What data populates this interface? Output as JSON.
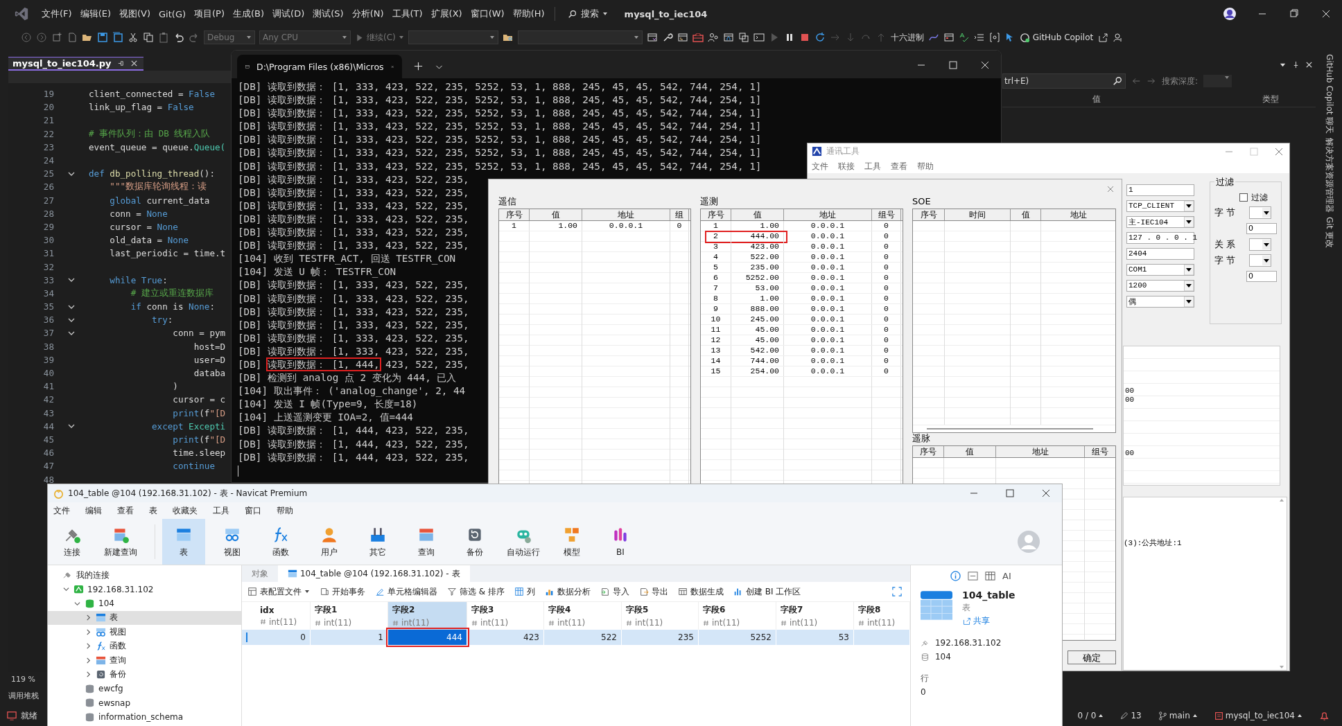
{
  "ide": {
    "menu": [
      "文件(F)",
      "编辑(E)",
      "视图(V)",
      "Git(G)",
      "项目(P)",
      "生成(B)",
      "调试(D)",
      "测试(S)",
      "分析(N)",
      "工具(T)",
      "扩展(X)",
      "窗口(W)",
      "帮助(H)"
    ],
    "search": "搜索",
    "title": "mysql_to_iec104",
    "toolbar": {
      "configuration": "Debug",
      "platform": "Any CPU",
      "continue": "继续(C)",
      "hex": "十六进制",
      "copilot": "GitHub Copilot"
    },
    "editor_tab": {
      "label": "mysql_to_iec104.py",
      "selected": true
    },
    "code": [
      {
        "number": "19",
        "tokens": [
          {
            "t": "client_connected = ",
            "kind": "plain"
          },
          {
            "t": "False",
            "kind": "keyword"
          }
        ]
      },
      {
        "number": "20",
        "tokens": [
          {
            "t": "link_up_flag = ",
            "kind": "plain"
          },
          {
            "t": "False",
            "kind": "keyword"
          }
        ]
      },
      {
        "number": "21"
      },
      {
        "number": "22",
        "tokens": [
          {
            "t": "# 事件队列：由 DB 线程入队",
            "kind": "comment"
          }
        ]
      },
      {
        "number": "23",
        "tokens": [
          {
            "t": "event_queue = queue.",
            "kind": "plain"
          },
          {
            "t": "Queue(",
            "kind": "class"
          }
        ]
      },
      {
        "number": "24"
      },
      {
        "number": "25",
        "expanded": true,
        "tokens": [
          {
            "t": "def ",
            "kind": "keyword"
          },
          {
            "t": "db_polling_thread",
            "kind": "func"
          },
          {
            "t": "():",
            "kind": "plain"
          }
        ]
      },
      {
        "number": "26",
        "tokens": [
          {
            "t": "    \"\"\"数据库轮询线程：读",
            "kind": "string"
          }
        ]
      },
      {
        "number": "27",
        "tokens": [
          {
            "t": "    global ",
            "kind": "keyword"
          },
          {
            "t": "current_data",
            "kind": "plain"
          }
        ]
      },
      {
        "number": "28",
        "tokens": [
          {
            "t": "    conn = ",
            "kind": "plain"
          },
          {
            "t": "None",
            "kind": "keyword"
          }
        ]
      },
      {
        "number": "29",
        "tokens": [
          {
            "t": "    cursor = ",
            "kind": "plain"
          },
          {
            "t": "None",
            "kind": "keyword"
          }
        ]
      },
      {
        "number": "30",
        "tokens": [
          {
            "t": "    old_data = ",
            "kind": "plain"
          },
          {
            "t": "None",
            "kind": "keyword"
          }
        ]
      },
      {
        "number": "31",
        "tokens": [
          {
            "t": "    last_periodic = time.t",
            "kind": "plain"
          }
        ]
      },
      {
        "number": "32"
      },
      {
        "number": "33",
        "expanded": true,
        "tokens": [
          {
            "t": "    while ",
            "kind": "keyword"
          },
          {
            "t": "True",
            "kind": "keyword"
          },
          {
            "t": ":",
            "kind": "plain"
          }
        ]
      },
      {
        "number": "34",
        "tokens": [
          {
            "t": "        # 建立或重连数据库",
            "kind": "comment"
          }
        ]
      },
      {
        "number": "35",
        "expanded": true,
        "tokens": [
          {
            "t": "        if ",
            "kind": "keyword"
          },
          {
            "t": "conn is ",
            "kind": "plain"
          },
          {
            "t": "None",
            "kind": "keyword"
          },
          {
            "t": ":",
            "kind": "plain"
          }
        ]
      },
      {
        "number": "36",
        "expanded": true,
        "tokens": [
          {
            "t": "            try",
            "kind": "keyword"
          },
          {
            "t": ":",
            "kind": "plain"
          }
        ]
      },
      {
        "number": "37",
        "expanded": true,
        "tokens": [
          {
            "t": "                conn = pym",
            "kind": "plain"
          }
        ]
      },
      {
        "number": "38",
        "tokens": [
          {
            "t": "                    host=D",
            "kind": "plain"
          }
        ]
      },
      {
        "number": "39",
        "tokens": [
          {
            "t": "                    user=D",
            "kind": "plain"
          }
        ]
      },
      {
        "number": "40",
        "tokens": [
          {
            "t": "                    databa",
            "kind": "plain"
          }
        ]
      },
      {
        "number": "41",
        "tokens": [
          {
            "t": "                )",
            "kind": "plain"
          }
        ]
      },
      {
        "number": "42",
        "tokens": [
          {
            "t": "                cursor = c",
            "kind": "plain"
          }
        ]
      },
      {
        "number": "43",
        "tokens": [
          {
            "t": "                print",
            "kind": "keyword"
          },
          {
            "t": "(f",
            "kind": "plain"
          },
          {
            "t": "\"[D",
            "kind": "string"
          }
        ]
      },
      {
        "number": "44",
        "expanded": true,
        "tokens": [
          {
            "t": "            except ",
            "kind": "keyword"
          },
          {
            "t": "Excepti",
            "kind": "class"
          }
        ]
      },
      {
        "number": "45",
        "tokens": [
          {
            "t": "                print",
            "kind": "keyword"
          },
          {
            "t": "(f",
            "kind": "plain"
          },
          {
            "t": "\"[D",
            "kind": "string"
          }
        ]
      },
      {
        "number": "46",
        "tokens": [
          {
            "t": "                time.sleep",
            "kind": "plain"
          }
        ]
      },
      {
        "number": "47",
        "tokens": [
          {
            "t": "                continue",
            "kind": "keyword"
          }
        ]
      },
      {
        "number": "48"
      }
    ],
    "zoom": "119 %",
    "bottom_tab": "调用堆栈",
    "watch": {
      "search": "trl+E)",
      "depth_label": "搜索深度:",
      "columns": [
        "值",
        "类型"
      ]
    },
    "side_tabs": [
      "GitHub Copilot 聊天",
      "解决方案资源管理器",
      "Git 更改"
    ],
    "status_bar": {
      "state": "就绪",
      "errors": "0 / 0",
      "changes": "13",
      "branch": "main",
      "repo": "mysql_to_iec104"
    }
  },
  "terminal": {
    "tab_title": "D:\\Program Files (x86)\\Micros",
    "lines": [
      {
        "kind": "plain",
        "text": "[DB] 读取到数据： [1, 333, 423, 522, 235, 5252, 53, 1, 888, 245, 45, 45, 542, 744, 254, 1]"
      },
      {
        "kind": "plain",
        "text": "[DB] 读取到数据： [1, 333, 423, 522, 235, 5252, 53, 1, 888, 245, 45, 45, 542, 744, 254, 1]"
      },
      {
        "kind": "plain",
        "text": "[DB] 读取到数据： [1, 333, 423, 522, 235, 5252, 53, 1, 888, 245, 45, 45, 542, 744, 254, 1]"
      },
      {
        "kind": "plain",
        "text": "[DB] 读取到数据： [1, 333, 423, 522, 235, 5252, 53, 1, 888, 245, 45, 45, 542, 744, 254, 1]"
      },
      {
        "kind": "plain",
        "text": "[DB] 读取到数据： [1, 333, 423, 522, 235, 5252, 53, 1, 888, 245, 45, 45, 542, 744, 254, 1]"
      },
      {
        "kind": "plain",
        "text": "[DB] 读取到数据： [1, 333, 423, 522, 235, 5252, 53, 1, 888, 245, 45, 45, 542, 744, 254, 1]"
      },
      {
        "kind": "plain",
        "text": "[DB] 读取到数据： [1, 333, 423, 522, 235, 5252, 53, 1, 888, 245, 45, 45, 542, 744, 254, 1]"
      },
      {
        "kind": "plain",
        "text": "[DB] 读取到数据： [1, 333, 423, 522, 235,"
      },
      {
        "kind": "plain",
        "text": "[DB] 读取到数据： [1, 333, 423, 522, 235,"
      },
      {
        "kind": "plain",
        "text": "[DB] 读取到数据： [1, 333, 423, 522, 235,"
      },
      {
        "kind": "plain",
        "text": "[DB] 读取到数据： [1, 333, 423, 522, 235,"
      },
      {
        "kind": "plain",
        "text": "[DB] 读取到数据： [1, 333, 423, 522, 235,"
      },
      {
        "kind": "plain",
        "text": "[DB] 读取到数据： [1, 333, 423, 522, 235,"
      },
      {
        "kind": "plain",
        "text": "[104] 收到 TESTFR_ACT, 回送 TESTFR_CON"
      },
      {
        "kind": "plain",
        "text": "[104] 发送 U 帧： TESTFR_CON"
      },
      {
        "kind": "plain",
        "text": "[DB] 读取到数据： [1, 333, 423, 522, 235,"
      },
      {
        "kind": "plain",
        "text": "[DB] 读取到数据： [1, 333, 423, 522, 235,"
      },
      {
        "kind": "plain",
        "text": "[DB] 读取到数据： [1, 333, 423, 522, 235,"
      },
      {
        "kind": "plain",
        "text": "[DB] 读取到数据： [1, 333, 423, 522, 235,"
      },
      {
        "kind": "plain",
        "text": "[DB] 读取到数据： [1, 333, 423, 522, 235,"
      },
      {
        "kind": "plain",
        "text": "[DB] 读取到数据： [1, 333, 423, 522, 235,"
      },
      {
        "kind": "boxed",
        "before": "[DB] ",
        "boxed": "读取到数据： [1, 444,",
        "after": " 423, 522, 235,"
      },
      {
        "kind": "plain",
        "text": "[DB] 检测到 analog 点 2 变化为 444, 已入"
      },
      {
        "kind": "plain",
        "text": "[104] 取出事件： ('analog_change', 2, 44"
      },
      {
        "kind": "plain",
        "text": "[104] 发送 I 帧(Type=9, 长度=18)"
      },
      {
        "kind": "plain",
        "text": "[104] 上送遥测变更 IOA=2, 值=444"
      },
      {
        "kind": "plain",
        "text": "[DB] 读取到数据： [1, 444, 423, 522, 235,"
      },
      {
        "kind": "plain",
        "text": "[DB] 读取到数据： [1, 444, 423, 522, 235,"
      },
      {
        "kind": "plain",
        "text": "[DB] 读取到数据： [1, 444, 423, 522, 235,"
      }
    ]
  },
  "comm_tool": {
    "title": "通讯工具",
    "menu": [
      "文件",
      "联接",
      "工具",
      "查看",
      "帮助"
    ],
    "settings": [
      {
        "kind": "text",
        "value": "1"
      },
      {
        "kind": "select",
        "value": "TCP_CLIENT"
      },
      {
        "kind": "select",
        "value": "主-IEC104"
      },
      {
        "kind": "text",
        "value": "127 . 0 . 0 . 1"
      },
      {
        "kind": "text",
        "value": "2404"
      },
      {
        "kind": "select",
        "value": "COM1"
      },
      {
        "kind": "select",
        "value": "1200"
      },
      {
        "kind": "select",
        "value": "偶"
      }
    ],
    "filter": {
      "title": "过滤",
      "checkbox": {
        "label": "过滤",
        "checked": false
      },
      "rows": [
        {
          "kind": "select",
          "label": "字 节"
        },
        {
          "kind": "text",
          "value": "0"
        },
        {
          "kind": "select",
          "label": "关 系"
        },
        {
          "kind": "select",
          "label": "字 节"
        },
        {
          "kind": "text",
          "value": "0"
        }
      ]
    },
    "log_fragments": [
      "00",
      "00",
      "00"
    ],
    "info": "(3):公共地址:1",
    "dialog": {
      "signals": {
        "title": "遥信",
        "columns": [
          "序号",
          "值",
          "地址",
          "组"
        ],
        "rows": [
          {
            "cells": [
              "1",
              "1.00",
              "0.0.0.1",
              "0"
            ],
            "highlighted": false
          }
        ]
      },
      "telemetry": {
        "title": "遥测",
        "columns": [
          "序号",
          "值",
          "地址",
          "组号"
        ],
        "rows": [
          {
            "cells": [
              "1",
              "1.00",
              "0.0.0.1",
              "0"
            ],
            "highlighted": false
          },
          {
            "cells": [
              "2",
              "444.00",
              "0.0.0.1",
              "0"
            ],
            "highlighted": true
          },
          {
            "cells": [
              "3",
              "423.00",
              "0.0.0.1",
              "0"
            ],
            "highlighted": false
          },
          {
            "cells": [
              "4",
              "522.00",
              "0.0.0.1",
              "0"
            ],
            "highlighted": false
          },
          {
            "cells": [
              "5",
              "235.00",
              "0.0.0.1",
              "0"
            ],
            "highlighted": false
          },
          {
            "cells": [
              "6",
              "5252.00",
              "0.0.0.1",
              "0"
            ],
            "highlighted": false
          },
          {
            "cells": [
              "7",
              "53.00",
              "0.0.0.1",
              "0"
            ],
            "highlighted": false
          },
          {
            "cells": [
              "8",
              "1.00",
              "0.0.0.1",
              "0"
            ],
            "highlighted": false
          },
          {
            "cells": [
              "9",
              "888.00",
              "0.0.0.1",
              "0"
            ],
            "highlighted": false
          },
          {
            "cells": [
              "10",
              "245.00",
              "0.0.0.1",
              "0"
            ],
            "highlighted": false
          },
          {
            "cells": [
              "11",
              "45.00",
              "0.0.0.1",
              "0"
            ],
            "highlighted": false
          },
          {
            "cells": [
              "12",
              "45.00",
              "0.0.0.1",
              "0"
            ],
            "highlighted": false
          },
          {
            "cells": [
              "13",
              "542.00",
              "0.0.0.1",
              "0"
            ],
            "highlighted": false
          },
          {
            "cells": [
              "14",
              "744.00",
              "0.0.0.1",
              "0"
            ],
            "highlighted": false
          },
          {
            "cells": [
              "15",
              "254.00",
              "0.0.0.1",
              "0"
            ],
            "highlighted": false
          }
        ]
      },
      "soe": {
        "title": "SOE",
        "columns": [
          "序号",
          "时间",
          "值",
          "地址"
        ]
      },
      "pulses": {
        "title": "遥脉",
        "columns": [
          "序号",
          "值",
          "地址",
          "组号"
        ]
      },
      "ok_button": "确定"
    }
  },
  "navicat": {
    "title": "104_table @104 (192.168.31.102) - 表 - Navicat Premium",
    "menu": [
      "文件",
      "编辑",
      "查看",
      "表",
      "收藏夹",
      "工具",
      "窗口",
      "帮助"
    ],
    "toolbar": [
      {
        "label": "连接",
        "kind": "connect",
        "selected": false
      },
      {
        "label": "新建查询",
        "kind": "newquery",
        "selected": false
      },
      {
        "label": "表",
        "kind": "table",
        "selected": true
      },
      {
        "label": "视图",
        "kind": "view",
        "selected": false
      },
      {
        "label": "函数",
        "kind": "function",
        "selected": false
      },
      {
        "label": "用户",
        "kind": "user",
        "selected": false
      },
      {
        "label": "其它",
        "kind": "other",
        "selected": false
      },
      {
        "label": "查询",
        "kind": "query",
        "selected": false
      },
      {
        "label": "备份",
        "kind": "backup",
        "selected": false
      },
      {
        "label": "自动运行",
        "kind": "robot",
        "selected": false
      },
      {
        "label": "模型",
        "kind": "model",
        "selected": false
      },
      {
        "label": "BI",
        "kind": "bi",
        "selected": false
      }
    ],
    "tree": [
      {
        "label": "我的连接",
        "kind": "group",
        "selected": false,
        "children": [
          {
            "label": "192.168.31.102",
            "kind": "server",
            "expanded": true,
            "selected": false,
            "children": [
              {
                "label": "104",
                "kind": "database",
                "expanded": true,
                "selected": false,
                "children": [
                  {
                    "label": "表",
                    "kind": "table",
                    "expanded": false,
                    "selected": true
                  },
                  {
                    "label": "视图",
                    "kind": "view",
                    "expanded": false,
                    "selected": false
                  },
                  {
                    "label": "函数",
                    "kind": "function",
                    "expanded": false,
                    "selected": false
                  },
                  {
                    "label": "查询",
                    "kind": "query",
                    "expanded": false,
                    "selected": false
                  },
                  {
                    "label": "备份",
                    "kind": "backup",
                    "expanded": false,
                    "selected": false
                  }
                ]
              },
              {
                "label": "ewcfg",
                "kind": "closed-db",
                "selected": false
              },
              {
                "label": "ewsnap",
                "kind": "closed-db",
                "selected": false
              },
              {
                "label": "information_schema",
                "kind": "closed-db",
                "selected": false
              }
            ]
          }
        ]
      }
    ],
    "tabs": [
      {
        "label": "对象",
        "selected": false
      },
      {
        "label": "104_table @104 (192.168.31.102) - 表",
        "selected": true
      }
    ],
    "actions": [
      "表配置文件",
      "开始事务",
      "单元格编辑器",
      "筛选 & 排序",
      "列",
      "数据分析",
      "导入",
      "导出",
      "数据生成",
      "创建 BI 工作区"
    ],
    "columns": [
      {
        "name": "idx",
        "type": "int(11)",
        "selected": false
      },
      {
        "name": "字段1",
        "type": "int(11)",
        "selected": false
      },
      {
        "name": "字段2",
        "type": "int(11)",
        "selected": true
      },
      {
        "name": "字段3",
        "type": "int(11)",
        "selected": false
      },
      {
        "name": "字段4",
        "type": "int(11)",
        "selected": false
      },
      {
        "name": "字段5",
        "type": "int(11)",
        "selected": false
      },
      {
        "name": "字段6",
        "type": "int(11)",
        "selected": false
      },
      {
        "name": "字段7",
        "type": "int(11)",
        "selected": false
      },
      {
        "name": "字段8",
        "type": "int(11)",
        "selected": false
      }
    ],
    "rows": [
      {
        "cells": [
          {
            "value": "0",
            "selected": false
          },
          {
            "value": "1",
            "selected": false
          },
          {
            "value": "444",
            "selected": true
          },
          {
            "value": "423",
            "selected": false
          },
          {
            "value": "522",
            "selected": false
          },
          {
            "value": "235",
            "selected": false
          },
          {
            "value": "5252",
            "selected": false
          },
          {
            "value": "53",
            "selected": false
          }
        ]
      }
    ],
    "info": {
      "ai": "AI",
      "name": "104_table",
      "type": "表",
      "share": "共享",
      "host": "192.168.31.102",
      "database": "104",
      "rows_label": "行",
      "rows": "0"
    }
  }
}
